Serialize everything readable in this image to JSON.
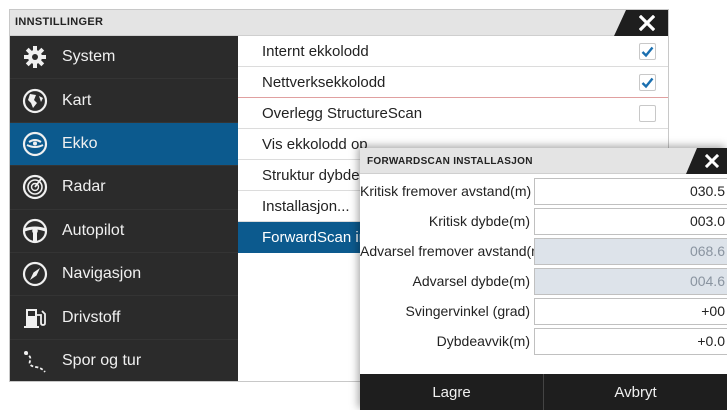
{
  "settings": {
    "title": "INNSTILLINGER",
    "sidebar": [
      {
        "label": "System",
        "icon": "gear-icon",
        "selected": false
      },
      {
        "label": "Kart",
        "icon": "globe-icon",
        "selected": false
      },
      {
        "label": "Ekko",
        "icon": "sonar-icon",
        "selected": true
      },
      {
        "label": "Radar",
        "icon": "radar-icon",
        "selected": false
      },
      {
        "label": "Autopilot",
        "icon": "steering-wheel-icon",
        "selected": false
      },
      {
        "label": "Navigasjon",
        "icon": "compass-icon",
        "selected": false
      },
      {
        "label": "Drivstoff",
        "icon": "fuel-pump-icon",
        "selected": false
      },
      {
        "label": "Spor og tur",
        "icon": "track-icon",
        "selected": false
      }
    ],
    "rows": [
      {
        "label": "Internt ekkolodd",
        "checked": true
      },
      {
        "label": "Nettverksekkolodd",
        "checked": true
      },
      {
        "label": "Overlegg StructureScan",
        "checked": false
      },
      {
        "label": "Vis ekkolodd op"
      },
      {
        "label": "Struktur dybdea"
      },
      {
        "label": "Installasjon..."
      },
      {
        "label": "ForwardScan in"
      }
    ]
  },
  "dialog": {
    "title": "FORWARDSCAN INSTALLASJON",
    "fields": [
      {
        "label": "Kritisk fremover avstand(m)",
        "value": "030.5",
        "enabled": true
      },
      {
        "label": "Kritisk dybde(m)",
        "value": "003.0",
        "enabled": true
      },
      {
        "label": "Advarsel fremover avstand(m)",
        "value": "068.6",
        "enabled": false
      },
      {
        "label": "Advarsel dybde(m)",
        "value": "004.6",
        "enabled": false
      },
      {
        "label": "Svingervinkel (grad)",
        "value": "+00",
        "enabled": true
      },
      {
        "label": "Dybdeavvik(m)",
        "value": "+0.0",
        "enabled": true
      }
    ],
    "buttons": {
      "save": "Lagre",
      "cancel": "Avbryt"
    }
  },
  "colors": {
    "accent": "#0c5a8e",
    "sidebar_bg": "#2b2b2b",
    "checkmark": "#1a6fb0"
  }
}
